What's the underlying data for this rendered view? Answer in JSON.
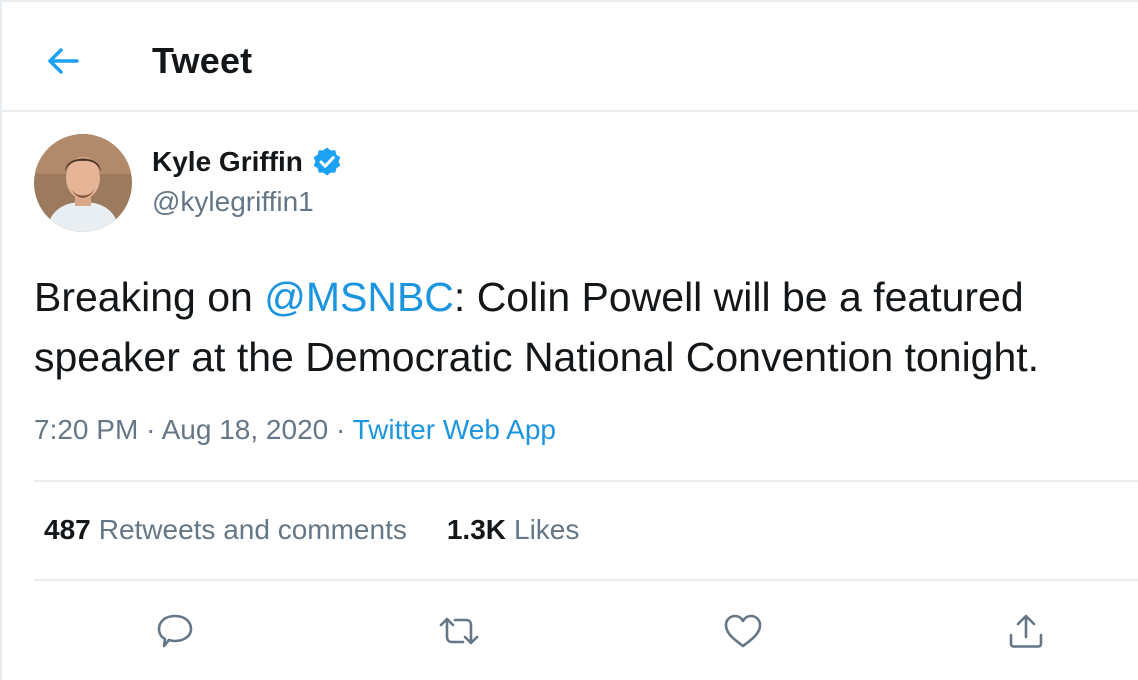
{
  "header": {
    "title": "Tweet",
    "back_icon": "arrow-left-icon"
  },
  "tweet": {
    "author": {
      "name": "Kyle Griffin",
      "handle": "@kylegriffin1",
      "verified": true
    },
    "text_before": "Breaking on ",
    "mention": "@MSNBC",
    "text_after": ": Colin Powell will be a featured speaker at the Democratic National Convention tonight.",
    "time": "7:20 PM",
    "date": "Aug 18, 2020",
    "separator": "·",
    "source": "Twitter Web App"
  },
  "stats": {
    "retweets_count": "487",
    "retweets_label": "Retweets and comments",
    "likes_count": "1.3K",
    "likes_label": "Likes"
  },
  "actions": [
    "reply-icon",
    "retweet-icon",
    "like-icon",
    "share-icon"
  ],
  "colors": {
    "accent": "#1da1f2",
    "link": "#1b95e0",
    "text": "#14171a",
    "muted": "#657786",
    "border": "#e6ecf0"
  }
}
